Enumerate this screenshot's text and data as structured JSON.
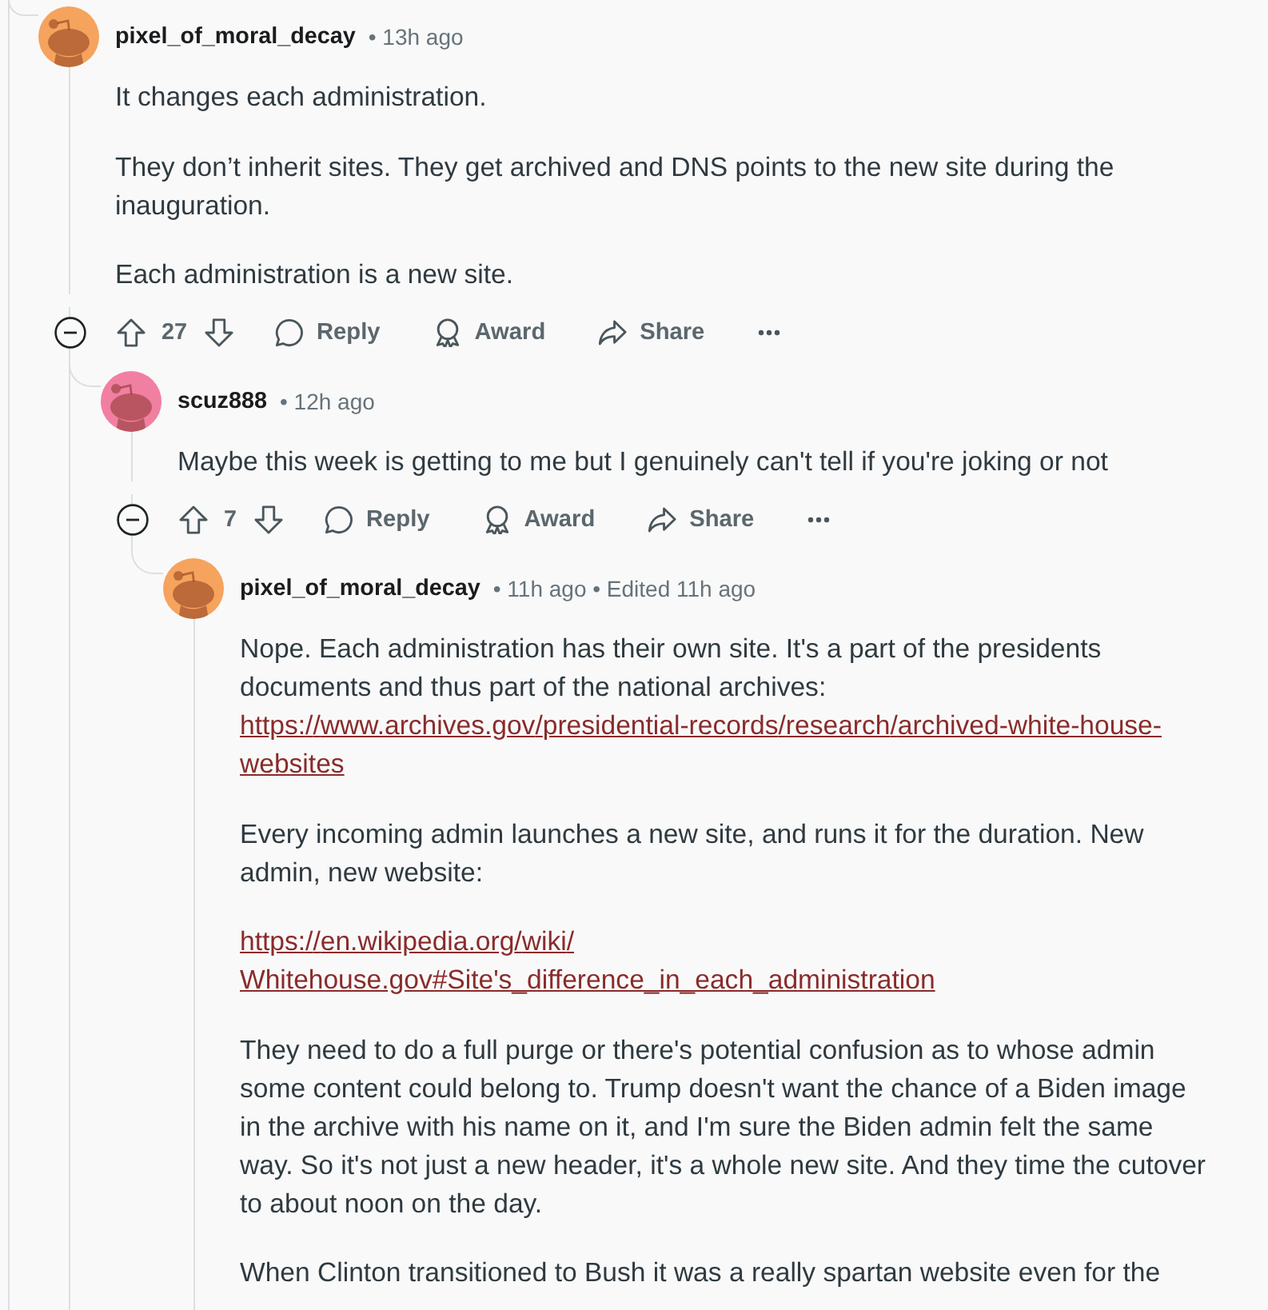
{
  "comments": [
    {
      "username": "pixel_of_moral_decay",
      "meta": "• 13h ago",
      "color": "#f6a35e",
      "paragraphs": [
        {
          "lines": [
            {
              "kind": "text",
              "text": "It changes each administration."
            }
          ]
        },
        {
          "lines": [
            {
              "kind": "text",
              "text": "They don’t inherit sites. They get archived and DNS points to the new site during the inauguration."
            }
          ]
        },
        {
          "lines": [
            {
              "kind": "text",
              "text": "Each administration is a new site."
            }
          ]
        }
      ],
      "expanded": true,
      "votes": "27",
      "actions": [
        {
          "kind": "reply",
          "label": "Reply"
        },
        {
          "kind": "award",
          "label": "Award"
        },
        {
          "kind": "share",
          "label": "Share"
        }
      ],
      "more_replies": true,
      "children": [
        {
          "username": "scuz888",
          "meta": "• 12h ago",
          "color": "#f17fa1",
          "paragraphs": [
            {
              "lines": [
                {
                  "kind": "text",
                  "text": "Maybe this week is getting to me but I genuinely can't tell if you're joking or not"
                }
              ]
            }
          ],
          "expanded": true,
          "votes": "7",
          "actions": [
            {
              "kind": "reply",
              "label": "Reply"
            },
            {
              "kind": "award",
              "label": "Award"
            },
            {
              "kind": "share",
              "label": "Share"
            }
          ],
          "more_replies": false,
          "children": [
            {
              "username": "pixel_of_moral_decay",
              "meta": "• 11h ago • Edited 11h ago",
              "color": "#f6a35e",
              "paragraphs": [
                {
                  "lines": [
                    {
                      "kind": "text",
                      "text": "Nope. Each administration has their own site. It's a part of the presidents documents and thus part of the national archives:"
                    },
                    {
                      "kind": "link",
                      "text": "https://www.archives.gov/presidential-records/research/archived-white-house-websites"
                    }
                  ]
                },
                {
                  "lines": [
                    {
                      "kind": "text",
                      "text": "Every incoming admin launches a new site, and runs it for the duration. New admin, new website:"
                    }
                  ]
                },
                {
                  "lines": [
                    {
                      "kind": "link",
                      "text": "https://en.wikipedia.org/wiki/Whitehouse.gov#Site's_difference_in_each_administration"
                    }
                  ]
                },
                {
                  "lines": [
                    {
                      "kind": "text",
                      "text": "They need to do a full purge or there's potential confusion as to whose admin some content could belong to. Trump doesn't want the chance of a Biden image in the archive with his name on it, and I'm sure the Biden admin felt the same way. So it's not just a new header, it's a whole new site. And they time the cutover to about noon on the day."
                    }
                  ]
                },
                {
                  "lines": [
                    {
                      "kind": "text",
                      "text": "When Clinton transitioned to Bush it was a really spartan website even for the"
                    }
                  ]
                }
              ]
            }
          ]
        }
      ]
    }
  ]
}
